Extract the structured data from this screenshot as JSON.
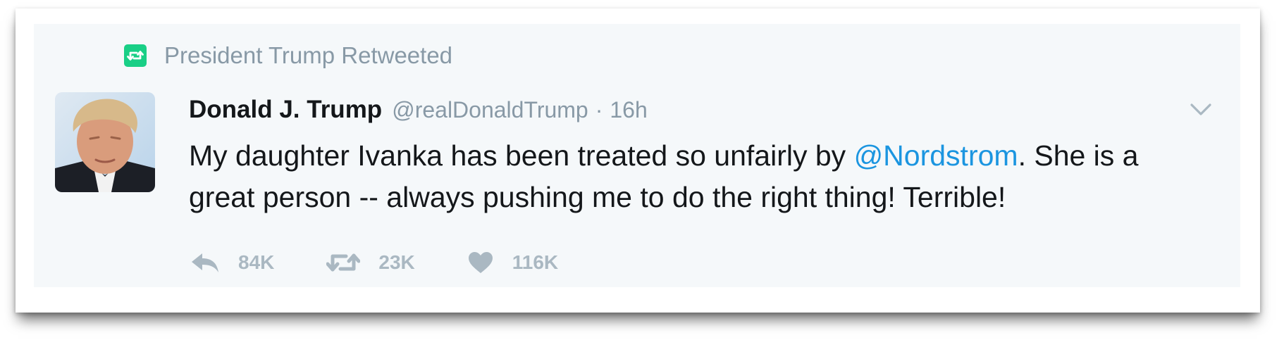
{
  "retweet_context": {
    "text": "President Trump Retweeted"
  },
  "tweet": {
    "fullname": "Donald J. Trump",
    "username": "@realDonaldTrump",
    "separator": "·",
    "timestamp": "16h",
    "text_before": "My daughter Ivanka has been treated so unfairly by ",
    "mention": "@Nordstrom",
    "text_after": ". She is a great person -- always pushing me to do the right thing! Terrible!"
  },
  "actions": {
    "reply_count": "84K",
    "retweet_count": "23K",
    "like_count": "116K"
  },
  "icons": {
    "retweet_badge": "retweet-icon",
    "reply": "reply-icon",
    "retweet": "retweet-icon",
    "like": "heart-icon",
    "menu": "chevron-down-icon"
  },
  "colors": {
    "retweet_green": "#19cf86",
    "mention_blue": "#1b95e0",
    "muted_gray": "#8899a6",
    "action_gray": "#aab8c2",
    "tweet_background": "#f5f8fa"
  }
}
